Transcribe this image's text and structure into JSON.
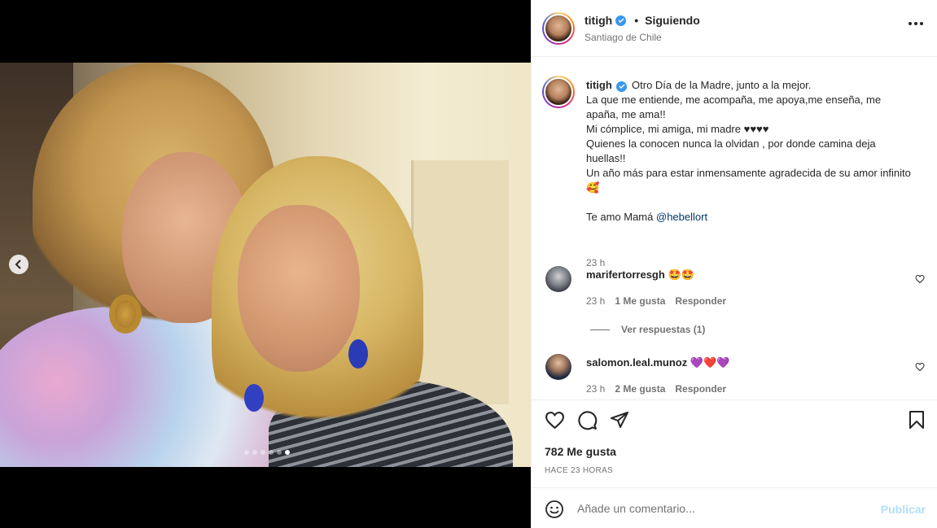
{
  "post": {
    "username": "titigh",
    "follow_status": "Siguiendo",
    "separator": "•",
    "location": "Santiago de Chile"
  },
  "caption": {
    "username": "titigh",
    "lines": [
      "Otro Día de la Madre, junto a la mejor.",
      "La que me entiende, me acompaña, me apoya,me enseña, me apaña, me ama!!",
      "Mi cómplice, mi amiga, mi madre ♥♥♥♥",
      "Quienes la conocen nunca la olvidan , por donde camina deja huellas!!",
      "Un año más para estar inmensamente agradecida de su amor infinito 🥰"
    ],
    "closing": "Te amo Mamá",
    "mention": "@hebellort",
    "time": "23 h"
  },
  "comments": [
    {
      "username": "marifertorresgh",
      "text": "🤩🤩",
      "time": "23 h",
      "likes": "1 Me gusta",
      "reply": "Responder",
      "view_replies": "Ver respuestas (1)"
    },
    {
      "username": "salomon.leal.munoz",
      "text": "💜❤️💜",
      "time": "23 h",
      "likes": "2 Me gusta",
      "reply": "Responder"
    }
  ],
  "actions": {
    "likes_count": "782 Me gusta",
    "posted_ago": "HACE 23 HORAS"
  },
  "add_comment": {
    "placeholder": "Añade un comentario...",
    "publish": "Publicar"
  },
  "carousel": {
    "slides": 6,
    "active_index": 5
  },
  "colors": {
    "verified": "#3897f0",
    "link": "#00376b",
    "publish_disabled": "#b2dffc",
    "muted": "#737373"
  }
}
